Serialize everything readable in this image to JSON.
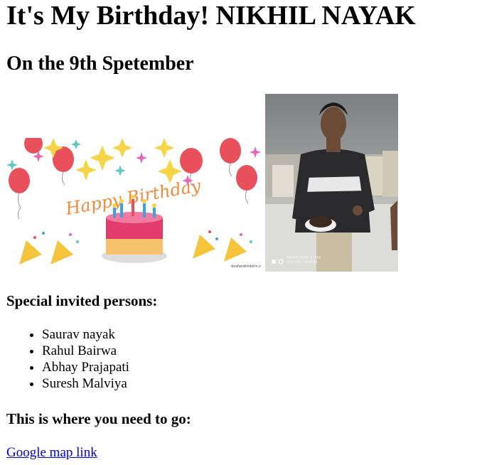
{
  "header": {
    "title": "It's My Birthday! NIKHIL NAYAK",
    "subtitle": "On the 9th Spetember"
  },
  "images": {
    "birthday_card": {
      "banner_text": "Happy Birthday",
      "watermark": "bosfandimbirin.c"
    },
    "person_photo": {
      "camera_line1": "REDMI NOTE 5 PRO",
      "camera_line2": "MI DUAL CAMERA"
    }
  },
  "invited": {
    "heading": "Special invited persons:",
    "people": [
      "Saurav nayak",
      "Rahul Bairwa",
      "Abhay Prajapati",
      "Suresh Malviya"
    ]
  },
  "directions": {
    "heading": "This is where you need to go:",
    "link_label": "Google map link"
  },
  "colors": {
    "link": "#0000ee",
    "balloon": "#e8505b",
    "sparkle": "#f5d547",
    "cake_top": "#e23c6c",
    "cake_base": "#f6c26b"
  }
}
